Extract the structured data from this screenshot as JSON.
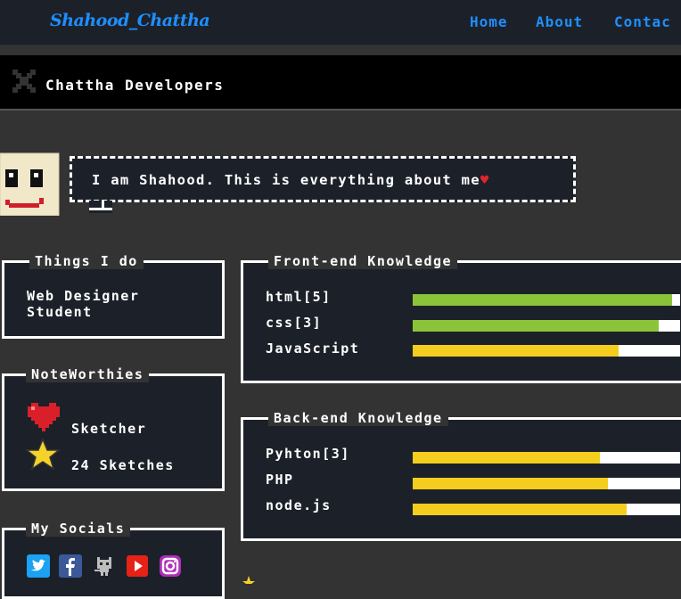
{
  "nav": {
    "brand": "Shahood_Chattha",
    "links": [
      "Home",
      "About",
      "Contac"
    ]
  },
  "window": {
    "title": "Chattha Developers"
  },
  "intro": {
    "text": "I am Shahood. This is everything about me",
    "heart": "♥"
  },
  "things_i_do": {
    "title": "Things I do",
    "lines": [
      "Web Designer",
      "Student"
    ]
  },
  "noteworthies": {
    "title": "NoteWorthies",
    "items": [
      {
        "icon": "heart-icon",
        "label": "Sketcher"
      },
      {
        "icon": "star-icon",
        "label": "24 Sketches"
      }
    ]
  },
  "socials": {
    "title": "My Socials",
    "icons": [
      "twitter-icon",
      "facebook-icon",
      "github-icon",
      "youtube-icon",
      "instagram-icon"
    ]
  },
  "frontend": {
    "title": "Front-end Knowledge",
    "skills": [
      {
        "name": "html[5]",
        "level": 0.97,
        "color": "#8bc43a"
      },
      {
        "name": "css[3]",
        "level": 0.92,
        "color": "#8bc43a"
      },
      {
        "name": "JavaScript",
        "level": 0.77,
        "color": "#f5cd1f"
      }
    ]
  },
  "backend": {
    "title": "Back-end Knowledge",
    "skills": [
      {
        "name": "Pyhton[3]",
        "level": 0.7,
        "color": "#f5cd1f"
      },
      {
        "name": "PHP",
        "level": 0.73,
        "color": "#f5cd1f"
      },
      {
        "name": "node.js",
        "level": 0.8,
        "color": "#f5cd1f"
      }
    ]
  },
  "colors": {
    "accent": "#1f8fff",
    "panel_bg": "#1c2129",
    "page_bg": "#333333"
  }
}
